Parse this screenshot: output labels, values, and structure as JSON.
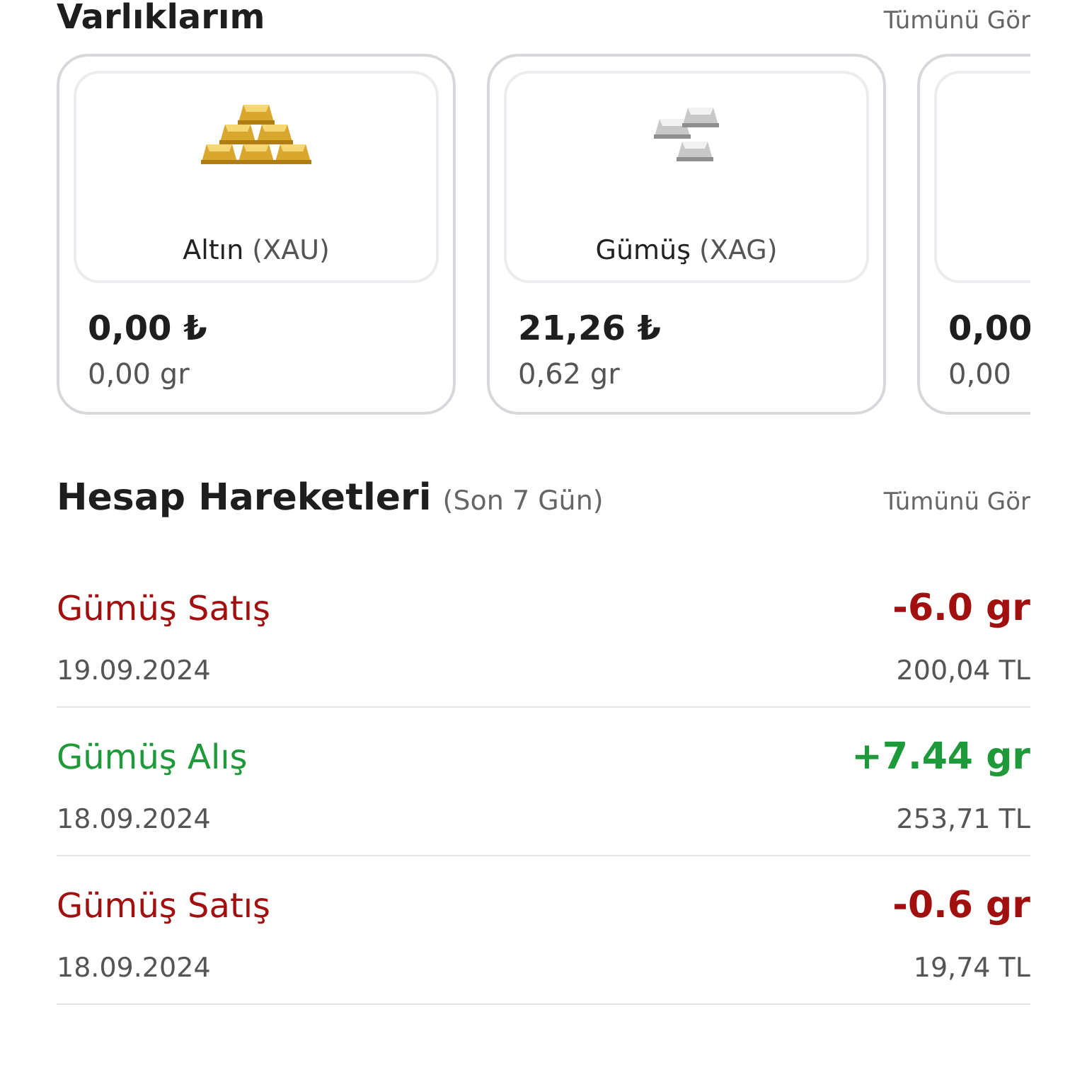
{
  "assets_header": {
    "title": "Varlıklarım",
    "link": "Tümünü Gör"
  },
  "assets": [
    {
      "kind": "gold",
      "name": "Altın",
      "code": "(XAU)",
      "value": "0,00 ₺",
      "weight": "0,00 gr"
    },
    {
      "kind": "silver",
      "name": "Gümüş",
      "code": "(XAG)",
      "value": "21,26 ₺",
      "weight": "0,62 gr"
    },
    {
      "kind": "partial",
      "value": "0,00",
      "weight": "0,00"
    }
  ],
  "transactions_header": {
    "title": "Hesap Hareketleri",
    "subtitle": "(Son 7 Gün)",
    "link": "Tümünü Gör"
  },
  "transactions": [
    {
      "kind": "sell",
      "title": "Gümüş Satış",
      "amount": "-6.0 gr",
      "date": "19.09.2024",
      "total": "200,04 TL"
    },
    {
      "kind": "buy",
      "title": "Gümüş Alış",
      "amount": "+7.44 gr",
      "date": "18.09.2024",
      "total": "253,71 TL"
    },
    {
      "kind": "sell",
      "title": "Gümüş Satış",
      "amount": "-0.6 gr",
      "date": "18.09.2024",
      "total": "19,74 TL"
    }
  ]
}
